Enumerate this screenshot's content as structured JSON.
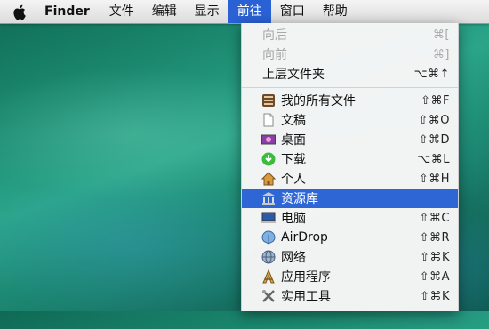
{
  "menubar": {
    "apple_icon": "apple-logo-icon",
    "items": [
      {
        "label": "Finder"
      },
      {
        "label": "文件"
      },
      {
        "label": "编辑"
      },
      {
        "label": "显示"
      },
      {
        "label": "前往"
      },
      {
        "label": "窗口"
      },
      {
        "label": "帮助"
      }
    ],
    "active_item": "前往",
    "highlight_color": "#2a61d4"
  },
  "menu": {
    "groups": [
      [
        {
          "label": "向后",
          "shortcut": "⌘[",
          "enabled": false
        },
        {
          "label": "向前",
          "shortcut": "⌘]",
          "enabled": false
        },
        {
          "label": "上层文件夹",
          "shortcut": "⌥⌘↑",
          "enabled": true
        }
      ],
      [
        {
          "label": "我的所有文件",
          "shortcut": "⇧⌘F",
          "icon": "all-my-files-icon"
        },
        {
          "label": "文稿",
          "shortcut": "⇧⌘O",
          "icon": "documents-icon"
        },
        {
          "label": "桌面",
          "shortcut": "⇧⌘D",
          "icon": "desktop-icon"
        },
        {
          "label": "下载",
          "shortcut": "⌥⌘L",
          "icon": "downloads-icon"
        },
        {
          "label": "个人",
          "shortcut": "⇧⌘H",
          "icon": "home-icon"
        },
        {
          "label": "资源库",
          "shortcut": "",
          "icon": "library-icon",
          "selected": true
        },
        {
          "label": "电脑",
          "shortcut": "⇧⌘C",
          "icon": "computer-icon"
        },
        {
          "label": "AirDrop",
          "shortcut": "⇧⌘R",
          "icon": "airdrop-icon"
        },
        {
          "label": "网络",
          "shortcut": "⇧⌘K",
          "icon": "network-icon"
        },
        {
          "label": "应用程序",
          "shortcut": "⇧⌘A",
          "icon": "applications-icon"
        },
        {
          "label": "实用工具",
          "shortcut": "⇧⌘K",
          "icon": "utilities-icon"
        }
      ]
    ]
  }
}
